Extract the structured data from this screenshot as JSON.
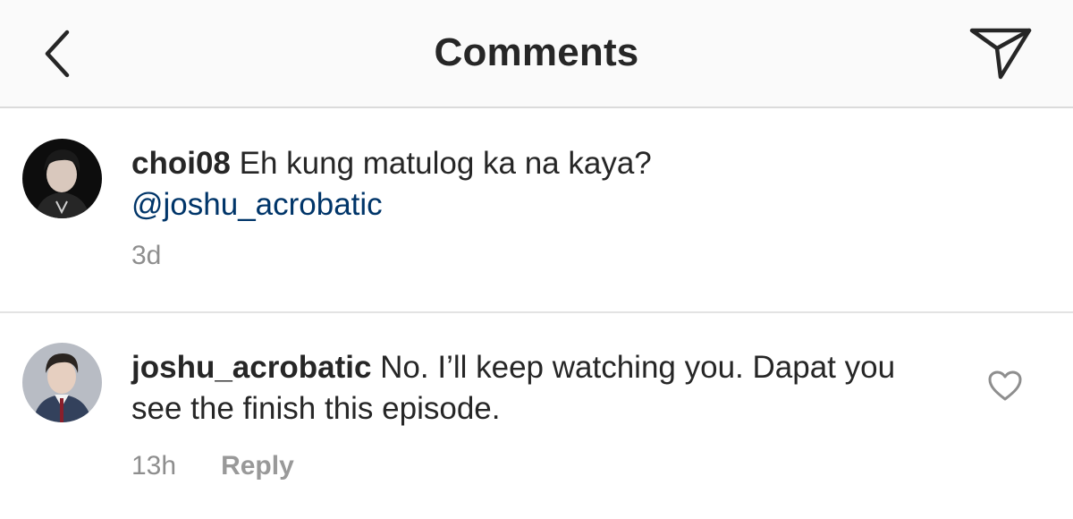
{
  "header": {
    "title": "Comments",
    "back_icon": "chevron-left-icon",
    "send_icon": "paper-plane-icon"
  },
  "comments": [
    {
      "username": "choi08",
      "text": "Eh kung matulog ka na kaya?",
      "mention": "@joshu_acrobatic",
      "time": "3d",
      "avatar_icon": "user-avatar"
    },
    {
      "username": "joshu_acrobatic",
      "text": "No. I’ll keep watching you. Dapat you see the finish this episode.",
      "time": "13h",
      "reply_label": "Reply",
      "like_icon": "heart-outline-icon",
      "avatar_icon": "user-avatar"
    }
  ],
  "colors": {
    "text": "#262626",
    "mention": "#003569",
    "meta": "#8e8e8e",
    "header_bg": "#fafafa",
    "divider": "#dbdbdb"
  }
}
